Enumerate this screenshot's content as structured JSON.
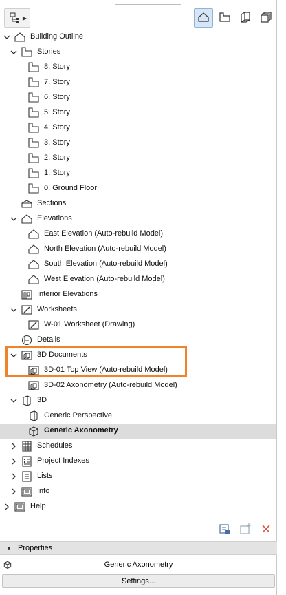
{
  "tree": {
    "building_outline": "Building Outline",
    "stories": "Stories",
    "story_items": [
      "8. Story",
      "7. Story",
      "6. Story",
      "5. Story",
      "4. Story",
      "3. Story",
      "2. Story",
      "1. Story",
      "0. Ground Floor"
    ],
    "sections": "Sections",
    "elevations": "Elevations",
    "elevation_items": [
      "East Elevation (Auto-rebuild Model)",
      "North Elevation (Auto-rebuild Model)",
      "South Elevation (Auto-rebuild Model)",
      "West Elevation (Auto-rebuild Model)"
    ],
    "interior_elevations": "Interior Elevations",
    "worksheets": "Worksheets",
    "worksheet_items": [
      "W-01 Worksheet (Drawing)"
    ],
    "details": "Details",
    "documents_3d": "3D Documents",
    "documents_3d_items": [
      "3D-01 Top View (Auto-rebuild Model)",
      "3D-02 Axonometry (Auto-rebuild Model)"
    ],
    "three_d": "3D",
    "three_d_items": [
      "Generic Perspective",
      "Generic Axonometry"
    ],
    "schedules": "Schedules",
    "project_indexes": "Project Indexes",
    "lists": "Lists",
    "info": "Info",
    "help": "Help"
  },
  "properties": {
    "header": "Properties",
    "selected_name": "Generic Axonometry",
    "settings_label": "Settings..."
  },
  "colors": {
    "highlight": "#f0822a",
    "selected_row": "#dcdcdc",
    "active_tab": "#d7e6f6",
    "delete_icon": "#e0533d"
  }
}
